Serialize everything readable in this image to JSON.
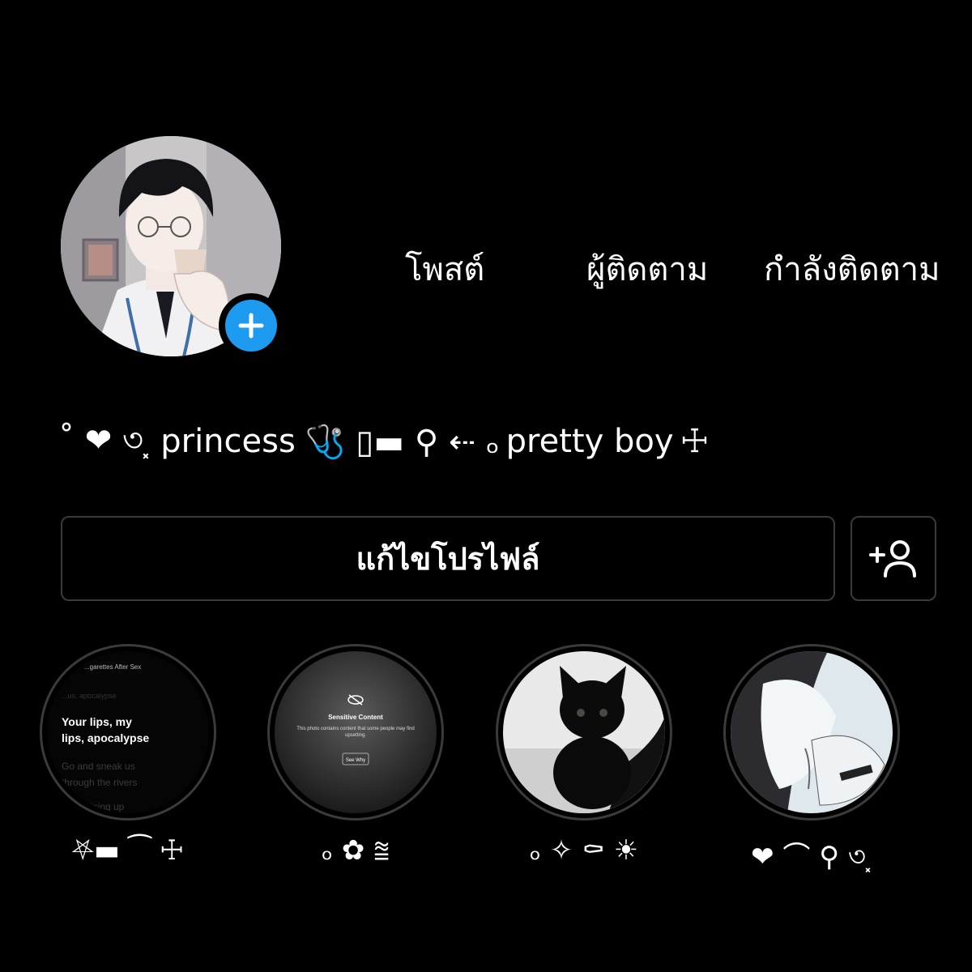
{
  "profile": {
    "avatar_icon": "anime-avatar",
    "add_story_icon": "plus-icon"
  },
  "stats": {
    "posts_label": "โพสต์",
    "followers_label": "ผู้ติดตาม",
    "following_label": "กำลังติดตาม"
  },
  "bio": {
    "text_princess": "princess",
    "text_pretty_boy": "pretty boy",
    "sym_start": "˚ ❤ ৩⸼",
    "sym_mid": "🩺 ▯▬ ⚲ ⇠ ₒ",
    "sym_end": "☩"
  },
  "actions": {
    "edit_profile_label": "แก้ไขโปรไฟล์",
    "add_person_icon": "add-person-icon"
  },
  "highlights": [
    {
      "label": "⛧▬ ⁀ ☩",
      "content": {
        "header": "...garettes After Sex",
        "line1": "Your lips, my",
        "line2": "lips, apocalypse",
        "faded1": "...us, apocalypse",
        "faded2": "Go and sneak us",
        "faded3": "through the rivers",
        "faded4": "...rising up"
      }
    },
    {
      "label": "ₒ ✿ ⩰",
      "content": {
        "title": "Sensitive Content",
        "body": "This photo contains content that some people may find upsetting.",
        "button": "See Why"
      }
    },
    {
      "label": "ₒ ✧ ⚰ ☀"
    },
    {
      "label": "❤ ⌒ ⚲ ৩⸼"
    }
  ],
  "colors": {
    "background": "#000000",
    "accent_blue": "#1d9bf0",
    "border": "#3a3a3a"
  }
}
